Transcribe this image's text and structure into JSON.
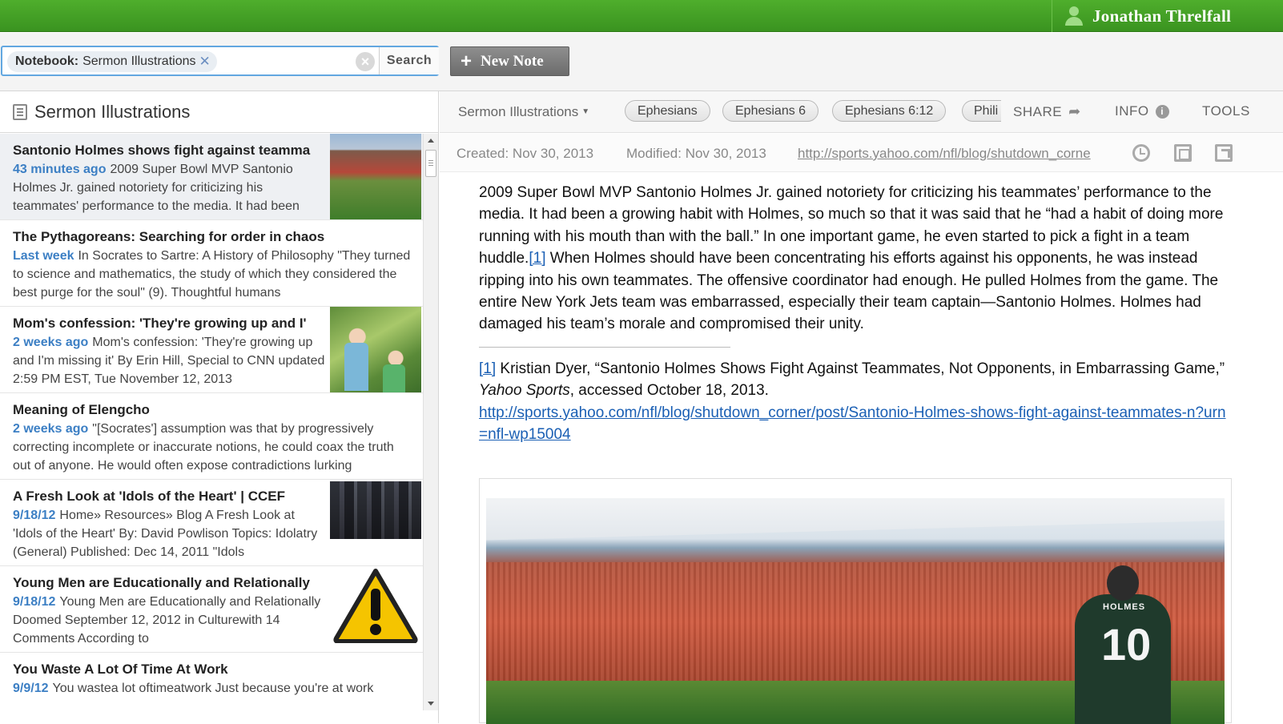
{
  "user": {
    "name": "Jonathan Threlfall"
  },
  "toolbar": {
    "filter_label": "Notebook:",
    "filter_value": "Sermon Illustrations",
    "search_label": "Search",
    "new_note_label": "New Note"
  },
  "sidebar": {
    "title": "Sermon Illustrations",
    "notes": [
      {
        "title": "Santonio Holmes shows fight against teamma",
        "time": "43 minutes ago",
        "snippet": "2009 Super Bowl MVP Santonio Holmes Jr. gained notoriety for criticizing his teammates' performance to the media. It had been",
        "thumb": "stadium"
      },
      {
        "title": "The Pythagoreans: Searching for order in chaos",
        "time": "Last week",
        "snippet": "In Socrates to Sartre: A History of Philosophy \"They turned to science and mathematics, the study of which they considered the best purge for the soul\" (9). Thoughtful humans",
        "thumb": ""
      },
      {
        "title": "Mom's confession: 'They're growing up and I'",
        "time": "2 weeks ago",
        "snippet": "Mom's confession: 'They're growing up and I'm missing it' By Erin Hill, Special to CNN updated 2:59 PM EST, Tue November 12, 2013",
        "thumb": "kids"
      },
      {
        "title": "Meaning of Elengcho",
        "time": "2 weeks ago",
        "snippet": "\"[Socrates'] assumption was that by progressively correcting incomplete or inaccurate notions, he could coax the truth out of anyone. He would often expose contradictions lurking",
        "thumb": ""
      },
      {
        "title": "A Fresh Look at 'Idols of the Heart' | CCEF",
        "time": "9/18/12",
        "snippet": "Home» Resources» Blog A Fresh Look at 'Idols of the Heart' By: David Powlison Topics: Idolatry (General) Published: Dec 14, 2011 \"Idols",
        "thumb": "city"
      },
      {
        "title": "Young Men are Educationally and Relationally",
        "time": "9/18/12",
        "snippet": "Young Men are Educationally and Relationally Doomed September 12, 2012 in Culturewith 14 Comments According to",
        "thumb": "warning"
      },
      {
        "title": "You Waste A Lot Of Time At Work",
        "time": "9/9/12",
        "snippet": "You wastea lot oftimeatwork Just because you're at work",
        "thumb": ""
      }
    ]
  },
  "note": {
    "notebook": "Sermon Illustrations",
    "tags": [
      "Ephesians",
      "Ephesians 6",
      "Ephesians 6:12",
      "Phili"
    ],
    "share_label": "SHARE",
    "info_label": "INFO",
    "tools_label": "TOOLS",
    "created": "Created: Nov 30, 2013",
    "modified": "Modified: Nov 30, 2013",
    "source_url": "http://sports.yahoo.com/nfl/blog/shutdown_corne",
    "body_part1": "2009 Super Bowl MVP Santonio Holmes Jr. gained notoriety for criticizing his teammates’ performance to the media. It had been a growing habit with Holmes, so much so that it was said that he “had a habit of doing more running with his mouth than with the ball.” In one important game, he even started to pick a fight in a team huddle.",
    "footnote_marker": "[1]",
    "body_part2": " When Holmes should have been concentrating his efforts against his opponents, he was instead ripping into his own teammates. The offensive coordinator had enough. He pulled Holmes from the game. The entire New York Jets team was embarrassed, especially their team captain—Santonio Holmes. Holmes had damaged his team’s morale and compromised their unity.",
    "footnote_text_a": " Kristian Dyer, “Santonio Holmes Shows Fight Against Teammates, Not Opponents, in Embarrassing Game,” ",
    "footnote_source": "Yahoo Sports",
    "footnote_text_b": ", accessed October 18, 2013.",
    "footnote_url": "http://sports.yahoo.com/nfl/blog/shutdown_corner/post/Santonio-Holmes-shows-fight-against-teammates-n?urn=nfl-wp15004",
    "image_jersey_number": "10",
    "image_jersey_name": "HOLMES"
  },
  "colors": {
    "topbar": "#3f9b24",
    "link": "#1a5fb4",
    "time": "#3c7fc4"
  }
}
